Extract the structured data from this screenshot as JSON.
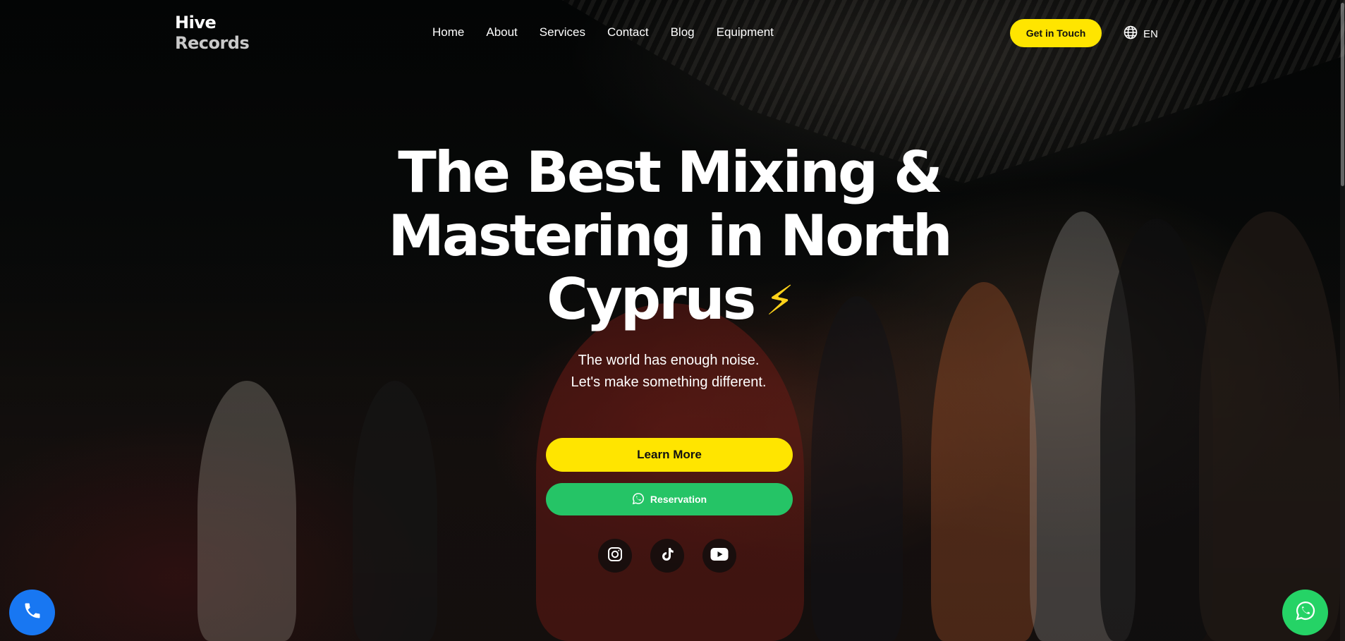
{
  "brand": {
    "line1": "Hive",
    "line2": "Records"
  },
  "nav": {
    "items": [
      {
        "label": "Home"
      },
      {
        "label": "About"
      },
      {
        "label": "Services"
      },
      {
        "label": "Contact"
      },
      {
        "label": "Blog"
      },
      {
        "label": "Equipment"
      }
    ]
  },
  "header": {
    "cta_label": "Get in Touch",
    "language": "EN",
    "language_icon": "globe-icon"
  },
  "hero": {
    "title_line1": "The Best Mixing &",
    "title_line2": "Mastering in North",
    "title_line3": "Cyprus",
    "title_emoji": "⚡",
    "subtitle_line1": "The world has enough noise.",
    "subtitle_line2": "Let's make something different.",
    "learn_more_label": "Learn More",
    "reservation_label": "Reservation",
    "reservation_icon": "whatsapp-icon"
  },
  "socials": [
    {
      "icon": "instagram-icon"
    },
    {
      "icon": "tiktok-icon"
    },
    {
      "icon": "youtube-icon"
    }
  ],
  "floating": {
    "call_icon": "phone-icon",
    "chat_icon": "whatsapp-icon"
  },
  "colors": {
    "accent_yellow": "#ffe500",
    "whatsapp_green": "#25c466",
    "call_blue": "#1877f2",
    "background": "#07090a"
  }
}
